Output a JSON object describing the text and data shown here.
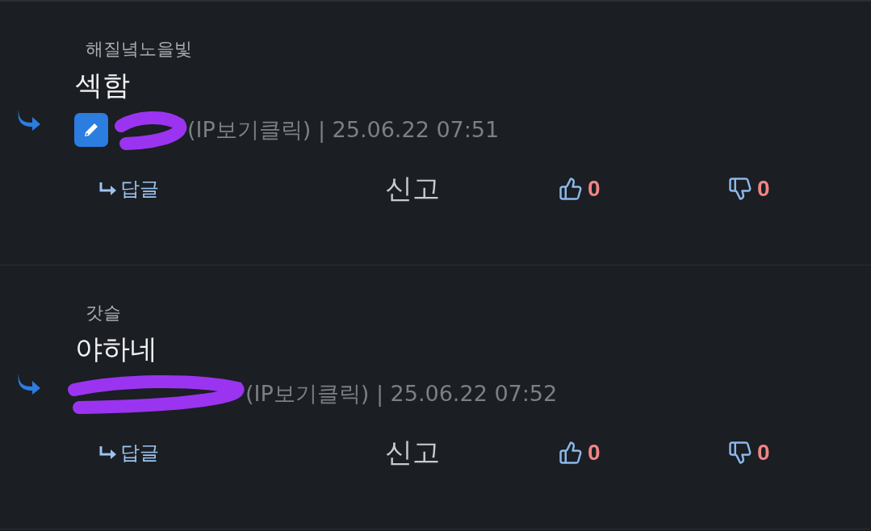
{
  "comments": [
    {
      "parent_author": "해질녘노을빛",
      "text": "섹함",
      "edited": true,
      "meta": "(IP보기클릭) | 25.06.22 07:51",
      "reply": "답글",
      "report": "신고",
      "likes": "0",
      "dislikes": "0"
    },
    {
      "parent_author": "갓슬",
      "text": "야하네",
      "edited": false,
      "meta": "(IP보기클릭) | 25.06.22 07:52",
      "reply": "답글",
      "report": "신고",
      "likes": "0",
      "dislikes": "0"
    }
  ]
}
